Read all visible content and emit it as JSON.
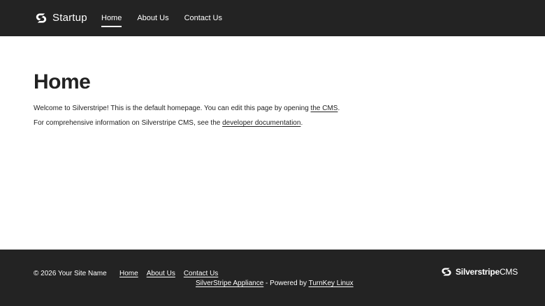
{
  "header": {
    "brand_icon": "silverstripe-logo-icon",
    "brand_name": "Startup",
    "nav": [
      {
        "label": "Home",
        "active": true
      },
      {
        "label": "About Us",
        "active": false
      },
      {
        "label": "Contact Us",
        "active": false
      }
    ]
  },
  "main": {
    "title": "Home",
    "paragraph_1": {
      "before": "Welcome to Silverstripe! This is the default homepage. You can edit this page by opening ",
      "link": "the CMS",
      "after": "."
    },
    "paragraph_2": {
      "before": "For comprehensive information on Silverstripe CMS, see the ",
      "link": "developer documentation",
      "after": "."
    }
  },
  "footer": {
    "copyright": "© 2026 Your Site Name",
    "nav": [
      {
        "label": "Home"
      },
      {
        "label": "About Us"
      },
      {
        "label": "Contact Us"
      }
    ],
    "powered": {
      "appliance_link": "SilverStripe Appliance",
      "middle": " - Powered by ",
      "turnkey_link": "TurnKey Linux"
    },
    "logo": {
      "icon": "silverstripe-logo-icon",
      "text_bold": "Silverstripe",
      "text_light": "CMS"
    }
  },
  "colors": {
    "header_bg": "#232323",
    "footer_bg": "#232323",
    "text": "#222222",
    "inverse_text": "#ffffff",
    "page_bg": "#ffffff"
  }
}
